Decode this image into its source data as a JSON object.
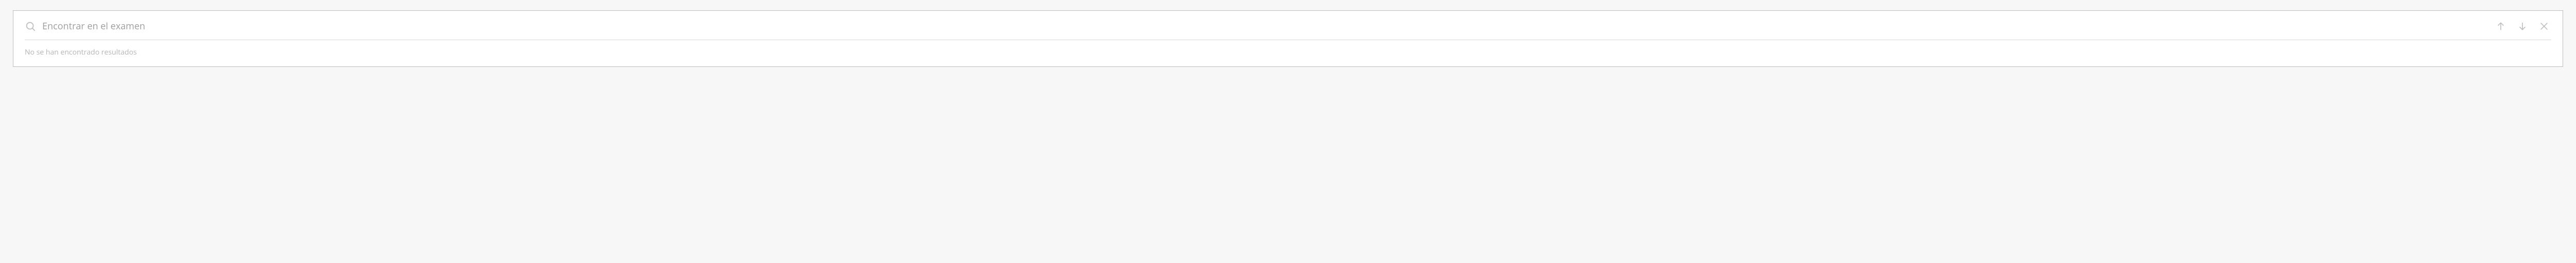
{
  "search": {
    "placeholder": "Encontrar en el examen",
    "value": ""
  },
  "status": {
    "no_results": "No se han encontrado resultados"
  },
  "icons": {
    "search": "search-icon",
    "prev": "arrow-up-icon",
    "next": "arrow-down-icon",
    "close": "close-icon"
  },
  "colors": {
    "icon_muted": "#bfbfbf",
    "placeholder": "#9e9e9e",
    "status_text": "#b5b5b5",
    "panel_border": "#bdbdbd",
    "row_border": "#d7d7d7",
    "page_bg": "#f7f7f7",
    "panel_bg": "#ffffff"
  }
}
